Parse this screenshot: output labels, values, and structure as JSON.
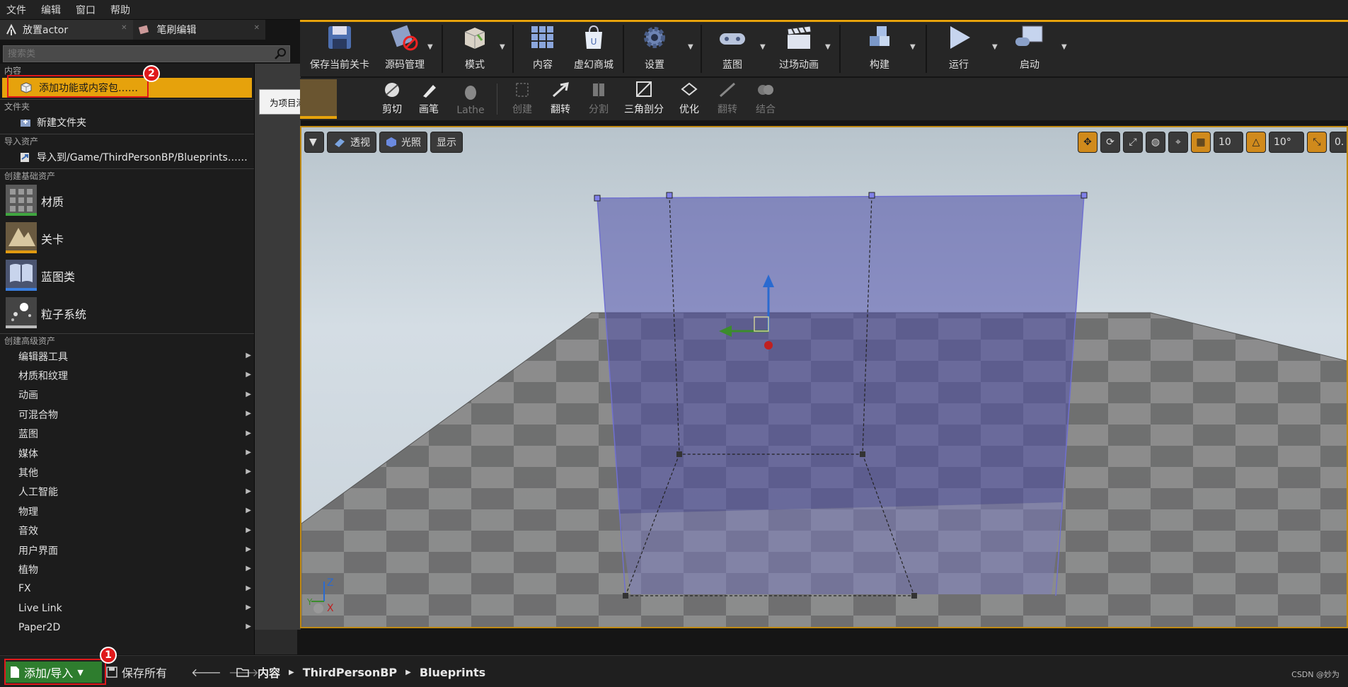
{
  "menubar": {
    "items": [
      "文件",
      "编辑",
      "窗口",
      "帮助"
    ]
  },
  "left_tabs": {
    "place_actor": "放置actor",
    "brush_edit": "笔刷编辑"
  },
  "search": {
    "placeholder": "搜索类"
  },
  "dropdown": {
    "section_content": "内容",
    "add_feature": "添加功能或内容包……",
    "section_folder": "文件夹",
    "new_folder": "新建文件夹",
    "section_import": "导入资产",
    "import_to": "导入到/Game/ThirdPersonBP/Blueprints……",
    "section_basic": "创建基础资产",
    "basic_assets": [
      "材质",
      "关卡",
      "蓝图类",
      "粒子系统"
    ],
    "section_advanced": "创建高级资产",
    "advanced_assets": [
      "编辑器工具",
      "材质和纹理",
      "动画",
      "可混合物",
      "蓝图",
      "媒体",
      "其他",
      "人工智能",
      "物理",
      "音效",
      "用户界面",
      "植物",
      "FX",
      "Live Link",
      "Paper2D"
    ]
  },
  "tooltip": {
    "text": "为项目添加功能及内容包。"
  },
  "badges": {
    "one": "1",
    "two": "2"
  },
  "main_toolbar": {
    "save_level": "保存当前关卡",
    "source_control": "源码管理",
    "modes": "模式",
    "content": "内容",
    "marketplace": "虚幻商城",
    "settings": "设置",
    "blueprints": "蓝图",
    "cinematics": "过场动画",
    "build": "构建",
    "play": "运行",
    "launch": "启动"
  },
  "brush_toolbar": {
    "clip": "剪切",
    "pen": "画笔",
    "lathe": "Lathe",
    "create": "创建",
    "flip": "翻转",
    "split": "分割",
    "triangulate": "三角剖分",
    "optimize": "优化",
    "flip2": "翻转",
    "combine": "结合"
  },
  "viewport": {
    "perspective": "透视",
    "lit": "光照",
    "show": "显示",
    "grid_snap": "10",
    "rotation_snap": "10°",
    "scale_snap": "0.",
    "axis_z": "Z",
    "axis_y": "Y",
    "axis_x": "X"
  },
  "bottom_bar": {
    "add_import": "添加/导入",
    "save_all": "保存所有",
    "breadcrumb": [
      "内容",
      "ThirdPersonBP",
      "Blueprints"
    ],
    "watermark": "CSDN @妙为"
  },
  "colors": {
    "accent": "#e6a20c",
    "add_button": "#2e7d2e",
    "badge": "#e0191b"
  }
}
